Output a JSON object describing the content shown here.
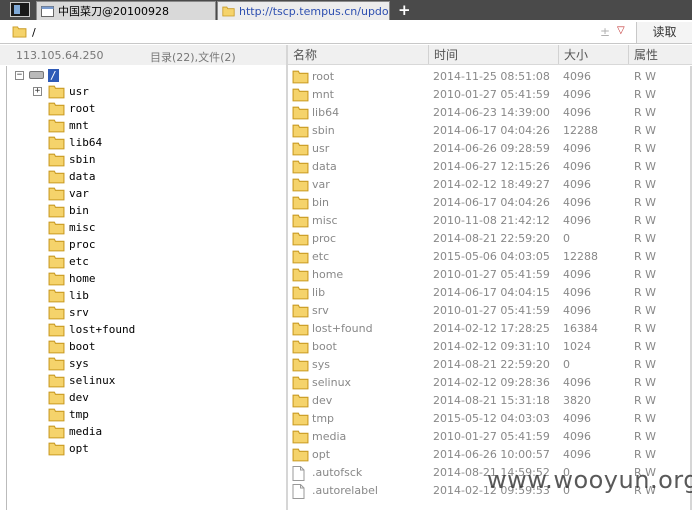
{
  "tabs": [
    {
      "label": "中国菜刀@20100928"
    },
    {
      "label": "http://tscp.tempus.cn/updow..."
    }
  ],
  "new_tab_glyph": "+",
  "pathbar": {
    "path": "/",
    "plus_glyph": "±",
    "read_label": "读取"
  },
  "info": {
    "ip": "113.105.64.250",
    "counts": "目录(22),文件(2)"
  },
  "tree": {
    "root": "/",
    "items": [
      {
        "label": "usr",
        "expandable": true
      },
      {
        "label": "root"
      },
      {
        "label": "mnt"
      },
      {
        "label": "lib64"
      },
      {
        "label": "sbin"
      },
      {
        "label": "data"
      },
      {
        "label": "var"
      },
      {
        "label": "bin"
      },
      {
        "label": "misc"
      },
      {
        "label": "proc"
      },
      {
        "label": "etc"
      },
      {
        "label": "home"
      },
      {
        "label": "lib"
      },
      {
        "label": "srv"
      },
      {
        "label": "lost+found"
      },
      {
        "label": "boot"
      },
      {
        "label": "sys"
      },
      {
        "label": "selinux"
      },
      {
        "label": "dev"
      },
      {
        "label": "tmp"
      },
      {
        "label": "media"
      },
      {
        "label": "opt"
      }
    ]
  },
  "columns": {
    "name": "名称",
    "time": "时间",
    "size": "大小",
    "attr": "属性"
  },
  "files": [
    {
      "name": "root",
      "time": "2014-11-25 08:51:08",
      "size": "4096",
      "attr": "R W",
      "type": "folder"
    },
    {
      "name": "mnt",
      "time": "2010-01-27 05:41:59",
      "size": "4096",
      "attr": "R W",
      "type": "folder"
    },
    {
      "name": "lib64",
      "time": "2014-06-23 14:39:00",
      "size": "4096",
      "attr": "R W",
      "type": "folder"
    },
    {
      "name": "sbin",
      "time": "2014-06-17 04:04:26",
      "size": "12288",
      "attr": "R W",
      "type": "folder"
    },
    {
      "name": "usr",
      "time": "2014-06-26 09:28:59",
      "size": "4096",
      "attr": "R W",
      "type": "folder"
    },
    {
      "name": "data",
      "time": "2014-06-27 12:15:26",
      "size": "4096",
      "attr": "R W",
      "type": "folder"
    },
    {
      "name": "var",
      "time": "2014-02-12 18:49:27",
      "size": "4096",
      "attr": "R W",
      "type": "folder"
    },
    {
      "name": "bin",
      "time": "2014-06-17 04:04:26",
      "size": "4096",
      "attr": "R W",
      "type": "folder"
    },
    {
      "name": "misc",
      "time": "2010-11-08 21:42:12",
      "size": "4096",
      "attr": "R W",
      "type": "folder"
    },
    {
      "name": "proc",
      "time": "2014-08-21 22:59:20",
      "size": "0",
      "attr": "R W",
      "type": "folder"
    },
    {
      "name": "etc",
      "time": "2015-05-06 04:03:05",
      "size": "12288",
      "attr": "R W",
      "type": "folder"
    },
    {
      "name": "home",
      "time": "2010-01-27 05:41:59",
      "size": "4096",
      "attr": "R W",
      "type": "folder"
    },
    {
      "name": "lib",
      "time": "2014-06-17 04:04:15",
      "size": "4096",
      "attr": "R W",
      "type": "folder"
    },
    {
      "name": "srv",
      "time": "2010-01-27 05:41:59",
      "size": "4096",
      "attr": "R W",
      "type": "folder"
    },
    {
      "name": "lost+found",
      "time": "2014-02-12 17:28:25",
      "size": "16384",
      "attr": "R W",
      "type": "folder"
    },
    {
      "name": "boot",
      "time": "2014-02-12 09:31:10",
      "size": "1024",
      "attr": "R W",
      "type": "folder"
    },
    {
      "name": "sys",
      "time": "2014-08-21 22:59:20",
      "size": "0",
      "attr": "R W",
      "type": "folder"
    },
    {
      "name": "selinux",
      "time": "2014-02-12 09:28:36",
      "size": "4096",
      "attr": "R W",
      "type": "folder"
    },
    {
      "name": "dev",
      "time": "2014-08-21 15:31:18",
      "size": "3820",
      "attr": "R W",
      "type": "folder"
    },
    {
      "name": "tmp",
      "time": "2015-05-12 04:03:03",
      "size": "4096",
      "attr": "R W",
      "type": "folder"
    },
    {
      "name": "media",
      "time": "2010-01-27 05:41:59",
      "size": "4096",
      "attr": "R W",
      "type": "folder"
    },
    {
      "name": "opt",
      "time": "2014-06-26 10:00:57",
      "size": "4096",
      "attr": "R W",
      "type": "folder"
    },
    {
      "name": ".autofsck",
      "time": "2014-08-21 14:59:52",
      "size": "0",
      "attr": "R W",
      "type": "file"
    },
    {
      "name": ".autorelabel",
      "time": "2014-02-12 09:59:53",
      "size": "0",
      "attr": "R W",
      "type": "file"
    }
  ],
  "watermark": "www.wooyun.org",
  "colors": {
    "folder_fill": "#f5d36b",
    "folder_stroke": "#c99a22",
    "selection": "#2f5bb7"
  }
}
